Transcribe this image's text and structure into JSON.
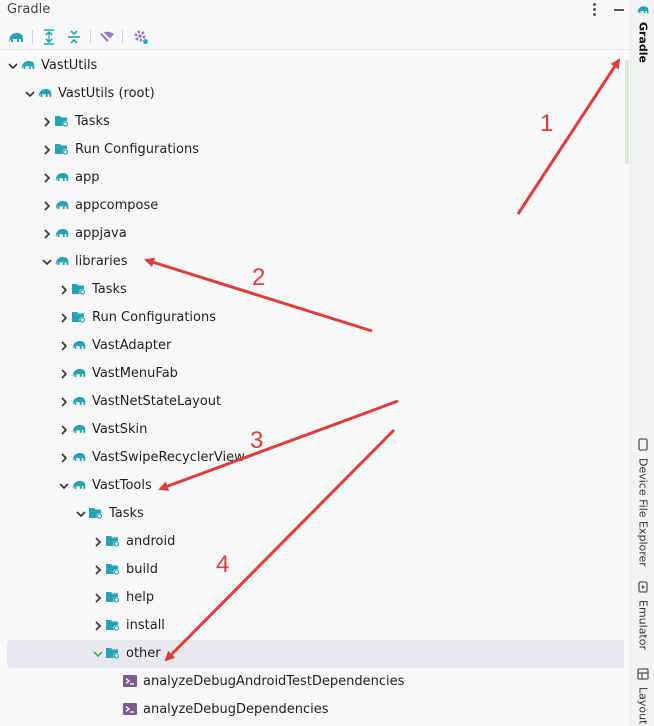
{
  "panel": {
    "title": "Gradle",
    "toolbar": [
      {
        "name": "elephant-icon"
      },
      {
        "name": "expand-all-icon"
      },
      {
        "name": "collapse-all-icon"
      },
      {
        "name": "toggle-offline-icon"
      },
      {
        "name": "gradle-settings-icon"
      }
    ]
  },
  "tree": [
    {
      "label": "VastUtils",
      "depth": 0,
      "icon": "gradle-elephant-icon",
      "state": "open"
    },
    {
      "label": "VastUtils (root)",
      "depth": 1,
      "icon": "gradle-elephant-icon",
      "state": "open"
    },
    {
      "label": "Tasks",
      "depth": 2,
      "icon": "tasks-folder-icon",
      "state": "closed"
    },
    {
      "label": "Run Configurations",
      "depth": 2,
      "icon": "tasks-folder-icon",
      "state": "closed"
    },
    {
      "label": "app",
      "depth": 2,
      "icon": "gradle-elephant-icon",
      "state": "closed"
    },
    {
      "label": "appcompose",
      "depth": 2,
      "icon": "gradle-elephant-icon",
      "state": "closed"
    },
    {
      "label": "appjava",
      "depth": 2,
      "icon": "gradle-elephant-icon",
      "state": "closed"
    },
    {
      "label": "libraries",
      "depth": 2,
      "icon": "gradle-elephant-icon",
      "state": "open"
    },
    {
      "label": "Tasks",
      "depth": 3,
      "icon": "tasks-folder-icon",
      "state": "closed"
    },
    {
      "label": "Run Configurations",
      "depth": 3,
      "icon": "tasks-folder-icon",
      "state": "closed"
    },
    {
      "label": "VastAdapter",
      "depth": 3,
      "icon": "gradle-elephant-icon",
      "state": "closed"
    },
    {
      "label": "VastMenuFab",
      "depth": 3,
      "icon": "gradle-elephant-icon",
      "state": "closed"
    },
    {
      "label": "VastNetStateLayout",
      "depth": 3,
      "icon": "gradle-elephant-icon",
      "state": "closed"
    },
    {
      "label": "VastSkin",
      "depth": 3,
      "icon": "gradle-elephant-icon",
      "state": "closed"
    },
    {
      "label": "VastSwipeRecyclerView",
      "depth": 3,
      "icon": "gradle-elephant-icon",
      "state": "closed"
    },
    {
      "label": "VastTools",
      "depth": 3,
      "icon": "gradle-elephant-icon",
      "state": "open"
    },
    {
      "label": "Tasks",
      "depth": 4,
      "icon": "tasks-folder-icon",
      "state": "open"
    },
    {
      "label": "android",
      "depth": 5,
      "icon": "tasks-folder-icon",
      "state": "closed"
    },
    {
      "label": "build",
      "depth": 5,
      "icon": "tasks-folder-icon",
      "state": "closed"
    },
    {
      "label": "help",
      "depth": 5,
      "icon": "tasks-folder-icon",
      "state": "closed"
    },
    {
      "label": "install",
      "depth": 5,
      "icon": "tasks-folder-icon",
      "state": "closed"
    },
    {
      "label": "other",
      "depth": 5,
      "icon": "tasks-folder-icon",
      "state": "open",
      "selected": true
    },
    {
      "label": "analyzeDebugAndroidTestDependencies",
      "depth": 6,
      "icon": "gradle-task-icon",
      "state": "leaf"
    },
    {
      "label": "analyzeDebugDependencies",
      "depth": 6,
      "icon": "gradle-task-icon",
      "state": "leaf"
    }
  ],
  "sidebar": {
    "tabs": [
      {
        "label": "Gradle",
        "icon": "gradle-elephant-icon",
        "active": true
      },
      {
        "label": "Device File Explorer",
        "icon": "device-icon",
        "active": false
      },
      {
        "label": "Emulator",
        "icon": "emulator-icon",
        "active": false
      },
      {
        "label": "Layout",
        "icon": "layout-icon",
        "active": false
      }
    ]
  },
  "annotations": [
    {
      "label": "1"
    },
    {
      "label": "2"
    },
    {
      "label": "3"
    },
    {
      "label": "4"
    }
  ],
  "colors": {
    "accent": "#27a3b8",
    "selected_row": "#e6e8ec",
    "annotation": "#e23b3b",
    "chevron_selected": "#4caf50"
  }
}
